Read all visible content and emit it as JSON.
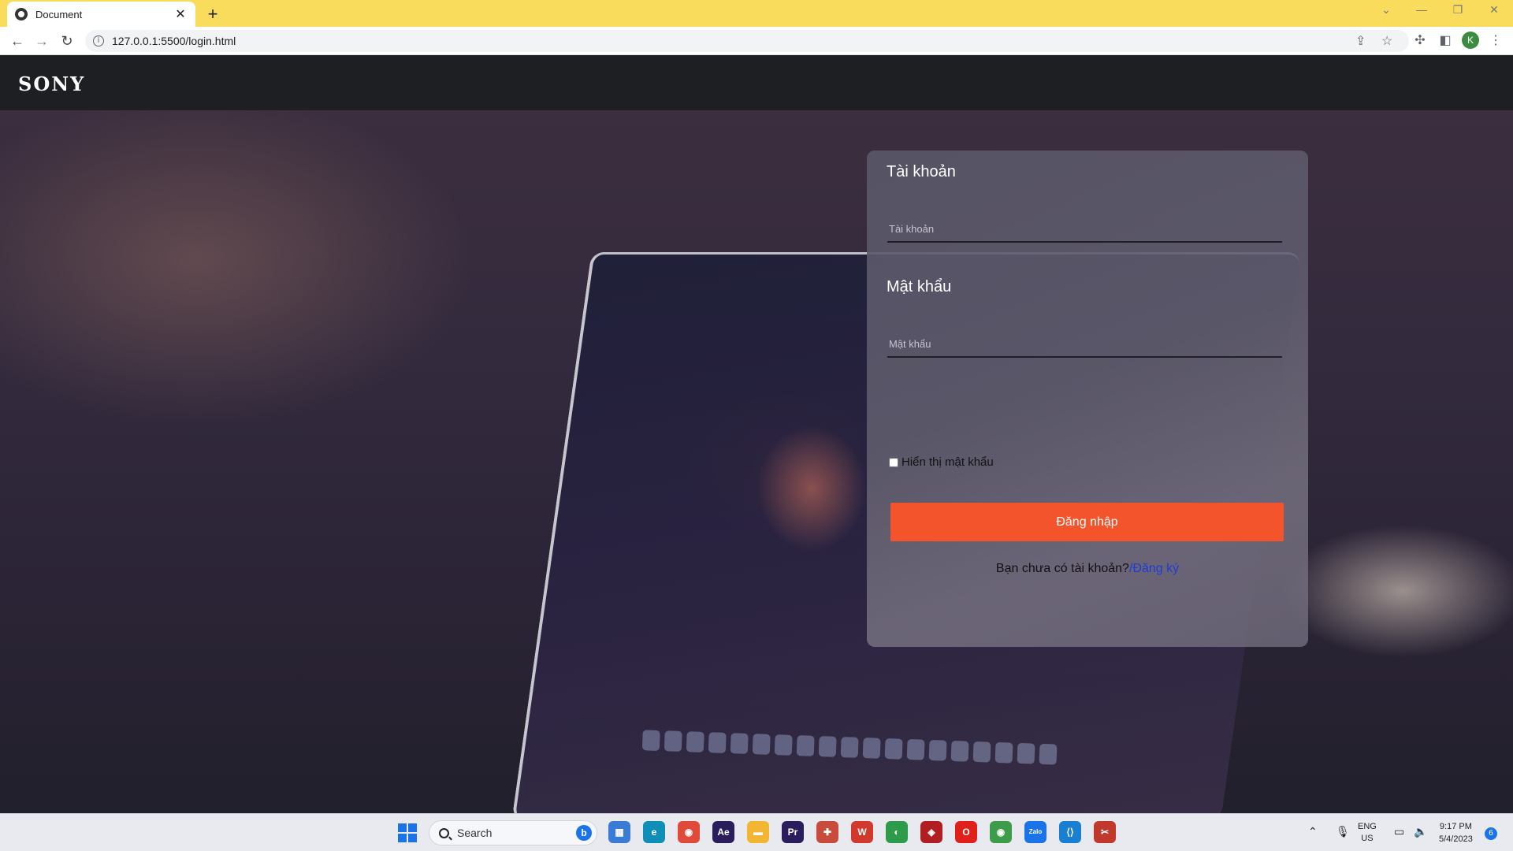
{
  "browser": {
    "tab_title": "Document",
    "tab_close": "✕",
    "new_tab": "+",
    "url": "127.0.0.1:5500/login.html",
    "profile_initial": "K",
    "window_controls": [
      "⌄",
      "—",
      "❐",
      "✕"
    ]
  },
  "site": {
    "logo": "SONY"
  },
  "login": {
    "username_label": "Tài khoản",
    "username_placeholder": "Tài khoản",
    "password_label": "Mật khẩu",
    "password_placeholder": "Mật khẩu",
    "show_password_label": "Hiển thị mật khẩu",
    "submit_label": "Đăng nhập",
    "register_prompt": "Bạn chưa có tài khoản?",
    "register_link": "/Đăng ký"
  },
  "taskbar": {
    "search_label": "Search",
    "language_line1": "ENG",
    "language_line2": "US",
    "time": "9:17 PM",
    "date": "5/4/2023",
    "notification_count": "6",
    "apps": [
      {
        "name": "file-manager-icon",
        "label": "▦",
        "color": "#3a7bd5"
      },
      {
        "name": "edge-icon",
        "label": "e",
        "color": "#0f8fb8"
      },
      {
        "name": "chrome-icon",
        "label": "◉",
        "color": "#e04a3b"
      },
      {
        "name": "after-effects-icon",
        "label": "Ae",
        "color": "#2b1d5c"
      },
      {
        "name": "folder-icon",
        "label": "▬",
        "color": "#f2b632"
      },
      {
        "name": "premiere-icon",
        "label": "Pr",
        "color": "#2b1d5c"
      },
      {
        "name": "photos-icon",
        "label": "✚",
        "color": "#c84b3c"
      },
      {
        "name": "wps-icon",
        "label": "W",
        "color": "#d0392b"
      },
      {
        "name": "spotify-like-icon",
        "label": "◐",
        "color": "#2e9b4a"
      },
      {
        "name": "app-red-icon",
        "label": "◈",
        "color": "#b11e22"
      },
      {
        "name": "opera-icon",
        "label": "O",
        "color": "#e0201b"
      },
      {
        "name": "chrome-profile-icon",
        "label": "◉",
        "color": "#3d9b4a"
      },
      {
        "name": "zalo-icon",
        "label": "Zalo",
        "color": "#1a73e8"
      },
      {
        "name": "vscode-icon",
        "label": "⟨⟩",
        "color": "#1b7fd1"
      },
      {
        "name": "snipping-tool-icon",
        "label": "✂",
        "color": "#c1392b"
      }
    ]
  }
}
